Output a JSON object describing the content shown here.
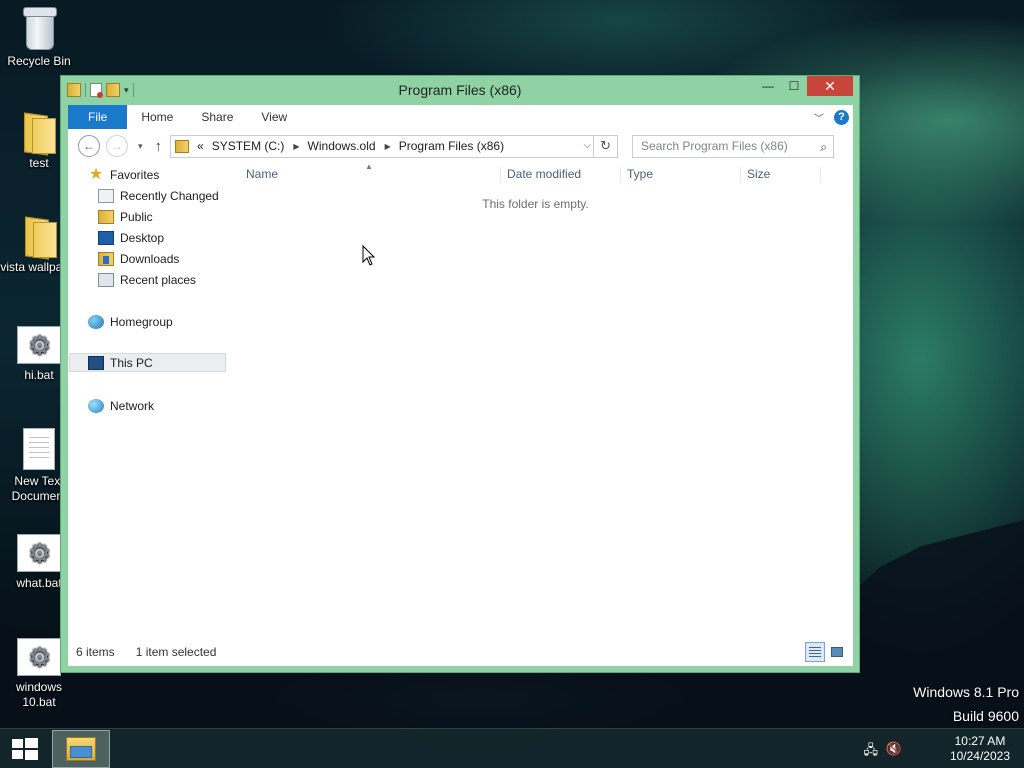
{
  "desktop": {
    "icons": [
      {
        "label": "Recycle Bin",
        "icon": "recycle-bin-icon"
      },
      {
        "label": "test",
        "icon": "folder-icon"
      },
      {
        "label": "vista wallpaper",
        "icon": "folder-icon"
      },
      {
        "label": "hi.bat",
        "icon": "batch-file-icon"
      },
      {
        "label": "New Text Document",
        "icon": "text-file-icon"
      },
      {
        "label": "what.bat",
        "icon": "batch-file-icon"
      },
      {
        "label": "windows 10.bat",
        "icon": "batch-file-icon"
      }
    ],
    "watermark": {
      "line1": "Windows 8.1 Pro",
      "line2": "Build 9600"
    }
  },
  "window": {
    "title": "Program Files (x86)",
    "controls": {
      "minimize": "—",
      "maximize": "☐",
      "close": "✕"
    },
    "ribbon_tabs": [
      "File",
      "Home",
      "Share",
      "View"
    ],
    "address": {
      "overflow": "«",
      "segments": [
        "SYSTEM (C:)",
        "Windows.old",
        "Program Files (x86)"
      ]
    },
    "search": {
      "placeholder": "Search Program Files (x86)"
    },
    "nav_pane": {
      "favorites": {
        "label": "Favorites",
        "items": [
          "Recently Changed",
          "Public",
          "Desktop",
          "Downloads",
          "Recent places"
        ]
      },
      "homegroup": "Homegroup",
      "this_pc": "This PC",
      "network": "Network"
    },
    "columns": [
      "Name",
      "Date modified",
      "Type",
      "Size"
    ],
    "empty_message": "This folder is empty.",
    "status": {
      "count": "6 items",
      "selection": "1 item selected"
    },
    "accent_color": "#1979ca",
    "frame_color": "#8fd3a4"
  },
  "taskbar": {
    "clock": {
      "time": "10:27 AM",
      "date": "10/24/2023"
    }
  }
}
